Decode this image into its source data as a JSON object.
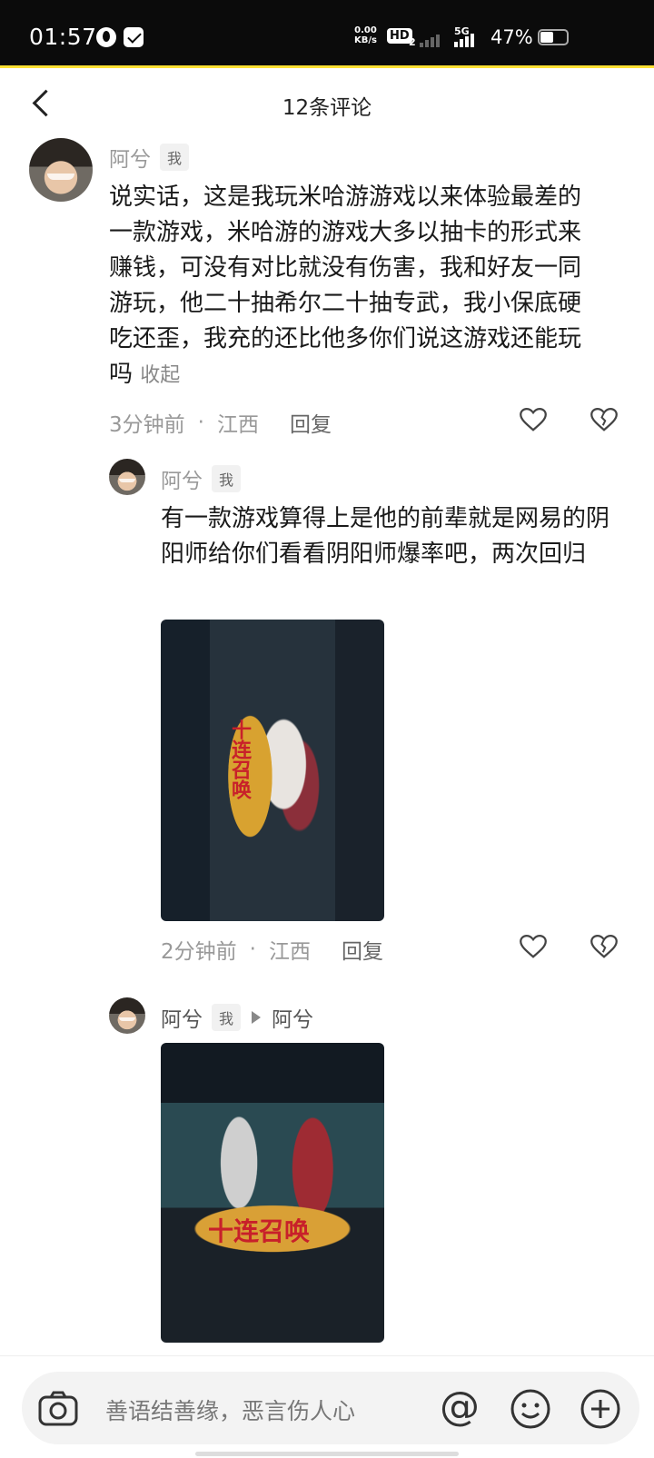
{
  "status_bar": {
    "time": "01:57",
    "speed_value": "0.00",
    "speed_unit": "KB/s",
    "hd_label": "HD",
    "hd_sub": "2",
    "network": "5G",
    "battery_pct": "47%"
  },
  "header": {
    "title": "12条评论"
  },
  "comments": [
    {
      "name": "阿兮",
      "badge": "我",
      "text": "说实话，这是我玩米哈游游戏以来体验最差的一款游戏，米哈游的游戏大多以抽卡的形式来赚钱，可没有对比就没有伤害，我和好友一同游玩，他二十抽希尔二十抽专武，我小保底硬吃还歪，我充的还比他多你们说这游戏还能玩吗",
      "collapse_label": "收起",
      "time": "3分钟前",
      "location": "江西",
      "reply_label": "回复"
    },
    {
      "name": "阿兮",
      "badge": "我",
      "text": "有一款游戏算得上是他的前辈就是网易的阴阳师给你们看看阴阳师爆率吧，两次回归",
      "image_caption": "十连召唤",
      "time": "2分钟前",
      "location": "江西",
      "reply_label": "回复"
    },
    {
      "name": "阿兮",
      "badge": "我",
      "reply_to": "阿兮",
      "image_caption": "十连召唤"
    }
  ],
  "input_bar": {
    "placeholder": "善语结善缘，恶言伤人心",
    "at_symbol": "@"
  },
  "icons": {
    "back": "chevron-left-icon",
    "like": "heart-icon",
    "dislike": "broken-heart-icon",
    "camera": "camera-icon",
    "emoji": "smiley-icon",
    "add": "plus-circle-icon"
  },
  "colors": {
    "accent_yellow": "#ffe033",
    "status_bar_bg": "#0b0b0b",
    "muted_text": "#999999"
  }
}
